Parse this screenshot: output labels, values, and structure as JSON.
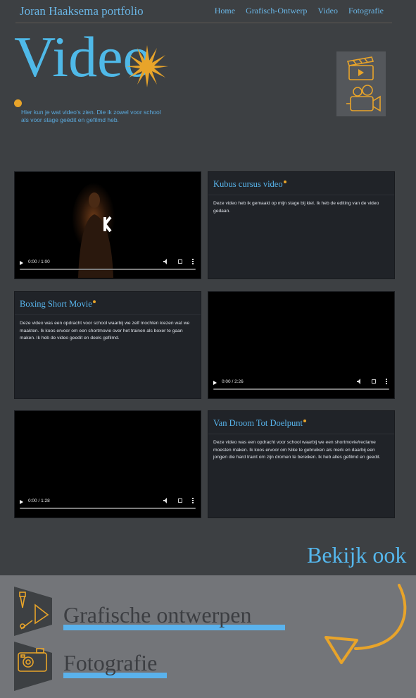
{
  "header": {
    "brand": "Joran Haaksema portfolio",
    "nav": [
      "Home",
      "Grafisch-Ontwerp",
      "Video",
      "Fotografie"
    ]
  },
  "hero": {
    "title": "Video",
    "description": "Hier kun je wat video's zien. Die ik zowel voor school als voor stage geëdit en gefilmd heb."
  },
  "videos": [
    {
      "title": "Kubus cursus video",
      "description": "Deze video heb ik gemaakt op mijn stage bij kiel. Ik heb de editing van de video gedaan.",
      "time": "0:00 / 1:00"
    },
    {
      "title": "Boxing Short Movie",
      "description": "Deze video was een opdracht voor school waarbij we zelf mochten kiezen wat we maakten. Ik koos ervoor om een shortmovie over het trainen als boxer te gaan maken. Ik heb de video geedit en deels gefilmd.",
      "time": "0:00 / 2:26"
    },
    {
      "title": "Van Droom Tot Doelpunt",
      "description": "Deze video was een opdracht voor school waarbij we een shortmovie/reclame moesten maken. Ik koos ervoor om Nike te gebruiken als merk en daarbij een jongen die hard traint om zijn dromen te bereiken. Ik heb alles gefilmd en geedit.",
      "time": "0:00 / 1:28"
    }
  ],
  "footer": {
    "heading": "Bekijk ook",
    "links": [
      "Grafische ontwerpen",
      "Fotografie"
    ]
  },
  "colors": {
    "background": "#3d4043",
    "accent_blue": "#4fb9e8",
    "accent_orange": "#e8a42a",
    "card": "#202328",
    "footer": "#737579"
  }
}
